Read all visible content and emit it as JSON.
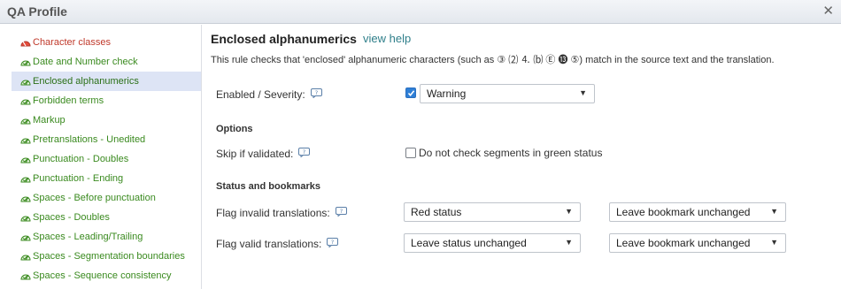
{
  "window": {
    "title": "QA Profile",
    "close_icon": "close-icon"
  },
  "sidebar": {
    "items": [
      {
        "label": "Character classes",
        "status": "error"
      },
      {
        "label": "Date and Number check",
        "status": "ok"
      },
      {
        "label": "Enclosed alphanumerics",
        "status": "ok",
        "selected": true
      },
      {
        "label": "Forbidden terms",
        "status": "ok"
      },
      {
        "label": "Markup",
        "status": "ok"
      },
      {
        "label": "Pretranslations - Unedited",
        "status": "ok"
      },
      {
        "label": "Punctuation - Doubles",
        "status": "ok"
      },
      {
        "label": "Punctuation - Ending",
        "status": "ok"
      },
      {
        "label": "Spaces - Before punctuation",
        "status": "ok"
      },
      {
        "label": "Spaces - Doubles",
        "status": "ok"
      },
      {
        "label": "Spaces - Leading/Trailing",
        "status": "ok"
      },
      {
        "label": "Spaces - Segmentation boundaries",
        "status": "ok"
      },
      {
        "label": "Spaces - Sequence consistency",
        "status": "ok"
      }
    ]
  },
  "main": {
    "title": "Enclosed alphanumerics",
    "help_link": "view help",
    "description": "This rule checks that 'enclosed' alphanumeric characters (such as ③ ⑵ ⒋ ⒝ Ⓔ ⓭ ⑤) match in the source text and the translation.",
    "enabled": {
      "label": "Enabled / Severity:",
      "checked": true,
      "severity": "Warning"
    },
    "options": {
      "heading": "Options",
      "skip_label": "Skip if validated:",
      "skip_checkbox_label": "Do not check segments in green status",
      "skip_checked": false
    },
    "status_bookmarks": {
      "heading": "Status and bookmarks",
      "invalid_label": "Flag invalid translations:",
      "invalid_status": "Red status",
      "invalid_bookmark": "Leave bookmark unchanged",
      "valid_label": "Flag valid translations:",
      "valid_status": "Leave status unchanged",
      "valid_bookmark": "Leave bookmark unchanged"
    }
  },
  "colors": {
    "ok": "#3a8a1f",
    "error": "#c0392b",
    "selected_bg": "#dde4f5",
    "link": "#2f7f8a"
  }
}
